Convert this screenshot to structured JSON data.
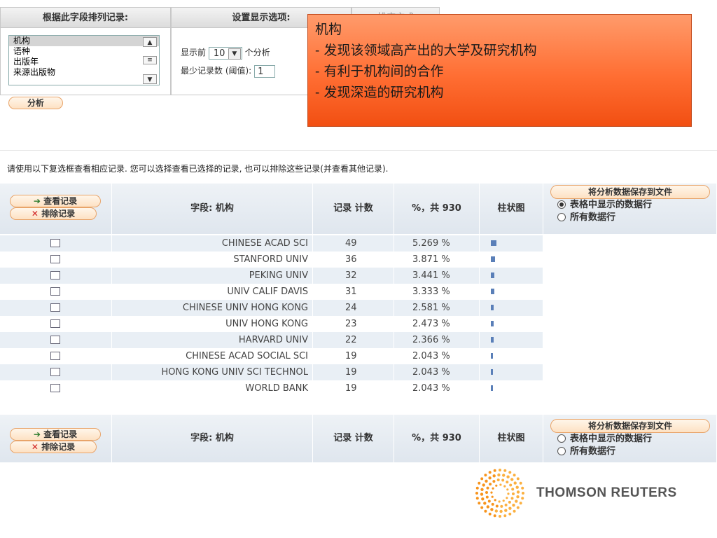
{
  "top_panel": {
    "header_sort": "根据此字段排列记录:",
    "header_display": "设置显示选项:",
    "header_third": "排序方式",
    "sort_list": [
      "机构",
      "语种",
      "出版年",
      "来源出版物"
    ],
    "show_top_label": "显示前",
    "show_top_value": "10",
    "show_top_suffix": "个分析",
    "min_records_label": "最少记录数 (阈值):",
    "min_records_value": "1",
    "analyze_button": "分析"
  },
  "overlay": {
    "title": "机构",
    "line1": "- 发现该领域高产出的大学及研究机构",
    "line2": "- 有利于机构间的合作",
    "line3": "- 发现深造的研究机构"
  },
  "hint": "请使用以下复选框查看相应记录. 您可以选择查看已选择的记录, 也可以排除这些记录(并查看其他记录).",
  "table": {
    "view_button": "查看记录",
    "exclude_button": "排除记录",
    "col_field": "字段: 机构",
    "col_count": "记录 计数",
    "col_percent": "%，共 930",
    "col_bar": "柱状图",
    "save_button": "将分析数据保存到文件",
    "save_opt1": "表格中显示的数据行",
    "save_opt2": "所有数据行",
    "rows": [
      {
        "name": "CHINESE ACAD SCI",
        "count": "49",
        "percent": "5.269 %",
        "pct_value": 5.269
      },
      {
        "name": "STANFORD UNIV",
        "count": "36",
        "percent": "3.871 %",
        "pct_value": 3.871
      },
      {
        "name": "PEKING UNIV",
        "count": "32",
        "percent": "3.441 %",
        "pct_value": 3.441
      },
      {
        "name": "UNIV CALIF DAVIS",
        "count": "31",
        "percent": "3.333 %",
        "pct_value": 3.333
      },
      {
        "name": "CHINESE UNIV HONG KONG",
        "count": "24",
        "percent": "2.581 %",
        "pct_value": 2.581
      },
      {
        "name": "UNIV HONG KONG",
        "count": "23",
        "percent": "2.473 %",
        "pct_value": 2.473
      },
      {
        "name": "HARVARD UNIV",
        "count": "22",
        "percent": "2.366 %",
        "pct_value": 2.366
      },
      {
        "name": "CHINESE ACAD SOCIAL SCI",
        "count": "19",
        "percent": "2.043 %",
        "pct_value": 2.043
      },
      {
        "name": "HONG KONG UNIV SCI TECHNOL",
        "count": "19",
        "percent": "2.043 %",
        "pct_value": 2.043
      },
      {
        "name": "WORLD BANK",
        "count": "19",
        "percent": "2.043 %",
        "pct_value": 2.043
      }
    ]
  },
  "logo": {
    "text": "THOMSON REUTERS",
    "icon": "thomson-reuters-dot-globe"
  },
  "colors": {
    "overlay": "#ff6e33",
    "bar": "#5a7fb8",
    "pill_border": "#e8a46a"
  }
}
